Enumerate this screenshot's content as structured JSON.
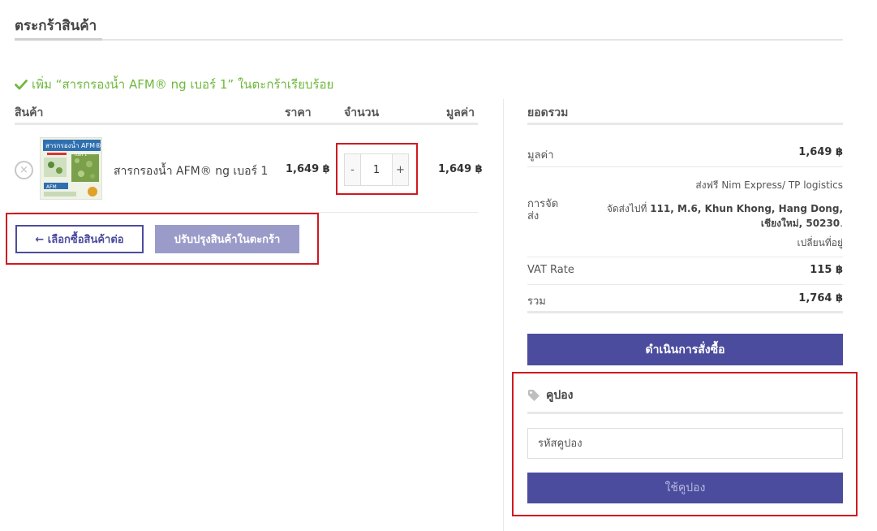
{
  "page": {
    "title": "ตระกร้าสินค้า"
  },
  "notice": {
    "text": "เพิ่ม “สารกรองน้ำ AFM® ng เบอร์ 1” ในตะกร้าเรียบร้อย"
  },
  "cart": {
    "headers": {
      "product": "สินค้า",
      "price": "ราคา",
      "quantity": "จำนวน",
      "subtotal": "มูลค่า"
    },
    "items": [
      {
        "name": "สารกรองน้ำ AFM® ng เบอร์ 1",
        "price": "1,649 ฿",
        "quantity": "1",
        "subtotal": "1,649 ฿",
        "thumb_text": "สารกรองน้ำ AFM®",
        "thumb_sub": "เบอร์ 1",
        "thumb_brand": "AFM"
      }
    ],
    "remove_symbol": "×",
    "qty_minus": "-",
    "qty_plus": "+",
    "continue_label": "← เลือกซื้อสินค้าต่อ",
    "update_label": "ปรับปรุงสินค้าในตะกร้า"
  },
  "totals": {
    "title": "ยอดรวม",
    "subtotal_label": "มูลค่า",
    "subtotal_value": "1,649 ฿",
    "shipping_label": "การจัดส่ง",
    "shipping_method": "ส่งฟรี Nim Express/ TP logistics",
    "shipping_prefix": "จัดส่งไปที่ ",
    "shipping_address": "111, M.6, Khun Khong, Hang Dong, เชียงใหม่, 50230",
    "shipping_suffix": ".",
    "change_address": "เปลี่ยนที่อยู่",
    "vat_label": "VAT Rate",
    "vat_value": "115 ฿",
    "total_label": "รวม",
    "total_value": "1,764 ฿",
    "checkout_label": "ดำเนินการสั่งซื้อ"
  },
  "coupon": {
    "title": "คูปอง",
    "placeholder": "รหัสคูปอง",
    "apply_label": "ใช้คูปอง"
  },
  "colors": {
    "accent": "#4b4c9e",
    "accent_light": "#9b9bca",
    "success": "#6fb83d",
    "highlight": "#d0191f"
  },
  "icons": {
    "notice": "checkmark-icon",
    "coupon": "tag-icon",
    "remove": "close-circle-icon"
  }
}
